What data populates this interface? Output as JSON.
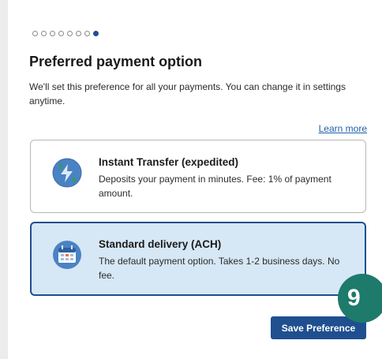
{
  "stepper": {
    "total_steps": 8,
    "current_step": 8
  },
  "header": {
    "title": "Preferred payment option",
    "description": "We'll set this preference for all your payments. You can change it in settings anytime."
  },
  "links": {
    "learn_more": "Learn more"
  },
  "options": [
    {
      "title": "Instant Transfer (expedited)",
      "description": "Deposits your payment in minutes. Fee: 1% of payment amount.",
      "icon": "instant-transfer-icon",
      "selected": false
    },
    {
      "title": "Standard delivery (ACH)",
      "description": "The default payment option. Takes 1-2 business days. No fee.",
      "icon": "calendar-icon",
      "selected": true
    }
  ],
  "actions": {
    "save_label": "Save Preference"
  },
  "badge": {
    "number": "9"
  },
  "colors": {
    "primary": "#1f4f8f",
    "selected_bg": "#d6e7f5",
    "link": "#1f5fa8",
    "badge": "#1e7a6a"
  }
}
